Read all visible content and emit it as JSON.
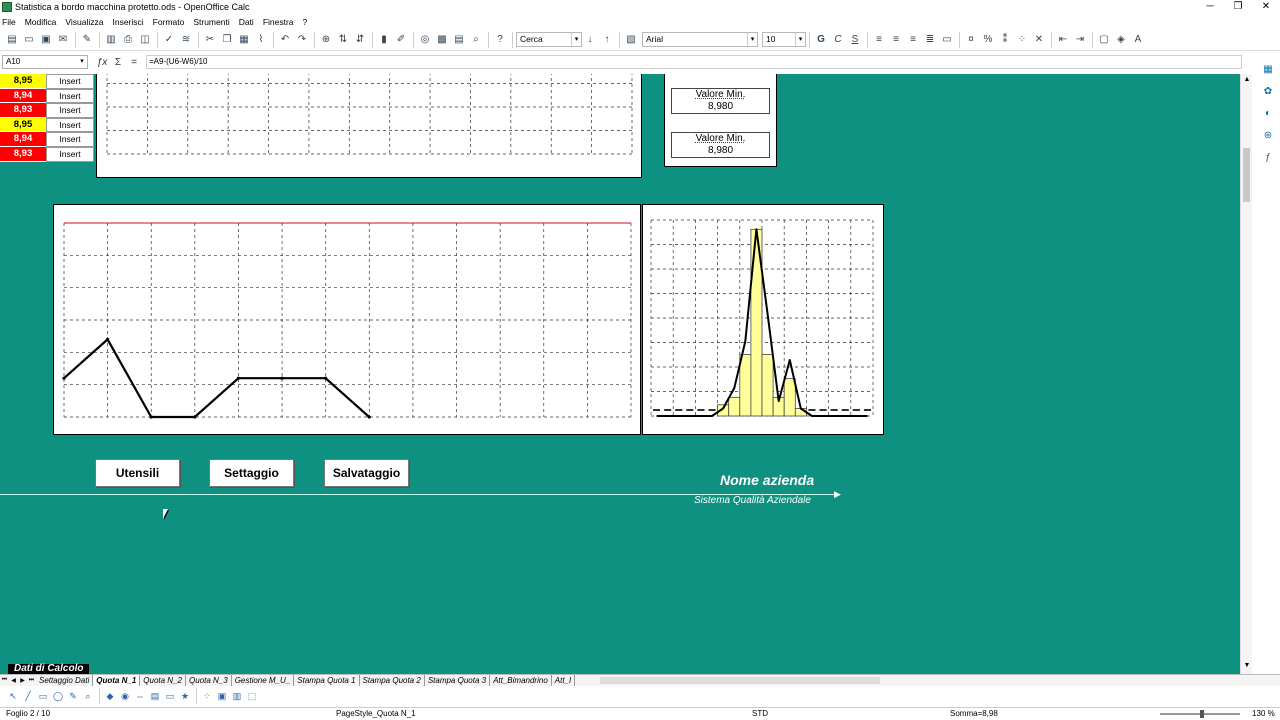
{
  "window": {
    "title": "Statistica a bordo macchina protetto.ods - OpenOffice Calc",
    "controls": [
      "─",
      "❐",
      "✕"
    ]
  },
  "menu": [
    "File",
    "Modifica",
    "Visualizza",
    "Inserisci",
    "Formato",
    "Strumenti",
    "Dati",
    "Finestra",
    "?"
  ],
  "toolbar": {
    "search_placeholder": "Cerca",
    "font_name": "Arial",
    "font_size": "10"
  },
  "formula_bar": {
    "cell_ref": "A10",
    "formula": "=A9-(U6-W6)/10",
    "function_icon": "ƒx",
    "sum_icon": "Σ",
    "equals_icon": "="
  },
  "mini_table": [
    {
      "value": "8,95",
      "color": "yellow",
      "button": "Insert"
    },
    {
      "value": "8,94",
      "color": "red",
      "button": "Insert"
    },
    {
      "value": "8,93",
      "color": "red",
      "button": "Insert"
    },
    {
      "value": "8,95",
      "color": "yellow",
      "button": "Insert"
    },
    {
      "value": "8,94",
      "color": "red",
      "button": "Insert"
    },
    {
      "value": "8,93",
      "color": "red",
      "button": "Insert"
    }
  ],
  "minmax": [
    {
      "label": "Valore Min.",
      "value": "8,980"
    },
    {
      "label": "Valore Min.",
      "value": "8,980"
    }
  ],
  "chart_data": [
    {
      "type": "line",
      "values": [
        1,
        2,
        0,
        0,
        1,
        1,
        1,
        0
      ],
      "ylim": [
        0,
        5
      ],
      "limit_line": 5,
      "grid": true,
      "colors": {
        "line": "#000000",
        "limit": "#c8102e"
      }
    },
    {
      "type": "bar",
      "values": [
        0,
        0,
        0,
        0,
        0,
        0,
        0.6,
        1,
        3.3,
        10,
        3.3,
        1,
        2,
        0.4,
        0,
        0,
        0,
        0,
        0,
        0
      ],
      "curve": [
        0,
        0,
        0,
        0,
        0,
        0,
        0.4,
        1.5,
        4,
        10,
        5.5,
        0.8,
        3,
        0.4,
        0,
        0,
        0,
        0,
        0,
        0
      ],
      "ylim": [
        0,
        10.5
      ],
      "grid": true,
      "colors": {
        "bar": "#ffff99",
        "curve": "#000000"
      }
    }
  ],
  "buttons": [
    {
      "label": "Utensili"
    },
    {
      "label": "Settaggio"
    },
    {
      "label": "Salvataggio"
    }
  ],
  "company": {
    "name": "Nome azienda",
    "subtitle": "Sistema Qualità Aziendale"
  },
  "bottom_label": "Dati di Calcolo",
  "sheet_tabs": [
    {
      "label": "Settaggio Dati",
      "active": false
    },
    {
      "label": "Quota N_1",
      "active": true
    },
    {
      "label": "Quota N_2",
      "active": false
    },
    {
      "label": "Quota N_3",
      "active": false
    },
    {
      "label": "Gestione M_U_",
      "active": false
    },
    {
      "label": "Stampa Quota 1",
      "active": false
    },
    {
      "label": "Stampa Quota 2",
      "active": false
    },
    {
      "label": "Stampa Quota 3",
      "active": false
    },
    {
      "label": "Att_Bimandrino",
      "active": false
    },
    {
      "label": "Att_I",
      "active": false
    }
  ],
  "status": {
    "sheet": "Foglio 2 / 10",
    "page_style": "PageStyle_Quota N_1",
    "mode": "STD",
    "sum": "Somma=8,98",
    "zoom": "130 %"
  }
}
